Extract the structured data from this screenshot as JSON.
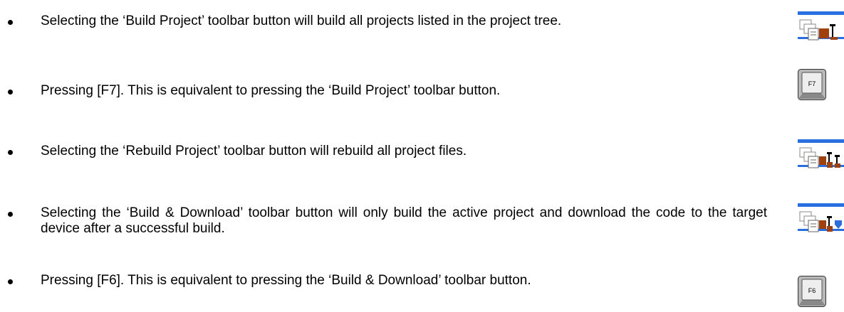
{
  "items": [
    {
      "text": "Selecting the ‘Build Project’ toolbar button will build all projects listed in the project tree.",
      "icon": "build-project-toolbar-icon"
    },
    {
      "text": "Pressing [F7]. This is equivalent to pressing the ‘Build Project’ toolbar button.",
      "icon": "f7-key-icon",
      "key_label": "F7"
    },
    {
      "text": "Selecting the ‘Rebuild Project’ toolbar button will rebuild all project files.",
      "icon": "rebuild-project-toolbar-icon"
    },
    {
      "text": "Selecting the ‘Build & Download’ toolbar button will only build the active project and download the code to the target device after a successful build.",
      "icon": "build-download-toolbar-icon"
    },
    {
      "text": "Pressing [F6]. This is equivalent to pressing the ‘Build & Download’ toolbar button.",
      "icon": "f6-key-icon",
      "key_label": "F6"
    }
  ],
  "colors": {
    "toolbar_blue": "#2a6fe0",
    "hammer_brown": "#a0400c",
    "key_grey": "#c0c0c0"
  }
}
